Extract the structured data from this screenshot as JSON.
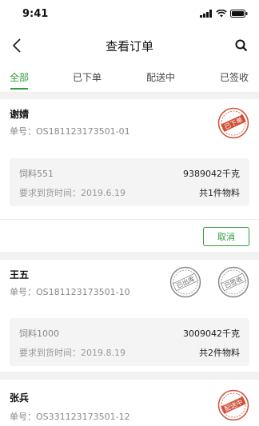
{
  "status_bar": {
    "time": "9:41"
  },
  "nav": {
    "title": "查看订单"
  },
  "tabs": [
    {
      "label": "全部"
    },
    {
      "label": "已下单"
    },
    {
      "label": "配送中"
    },
    {
      "label": "已签收"
    }
  ],
  "orders": [
    {
      "name": "谢婧",
      "order_no": "单号：OS181123173501-01",
      "stamps": [
        "已下单"
      ],
      "item": "饲料551",
      "weight": "9389042千克",
      "due": "要求到货时间：2019.6.19",
      "count": "共1件物料",
      "action": "取消"
    },
    {
      "name": "王五",
      "order_no": "单号：OS181123173501-10",
      "stamps": [
        "已出库",
        "已签收"
      ],
      "item": "饲料1000",
      "weight": "3009042千克",
      "due": "要求到货时间：2019.8.19",
      "count": "共2件物料"
    },
    {
      "name": "张兵",
      "order_no": "单号：OS331123173501-12",
      "stamps": [
        "配送中"
      ]
    }
  ],
  "colors": {
    "accent": "#2e9e3c",
    "stamp_red": "#d0523a",
    "stamp_grey": "#8a8a8a"
  }
}
